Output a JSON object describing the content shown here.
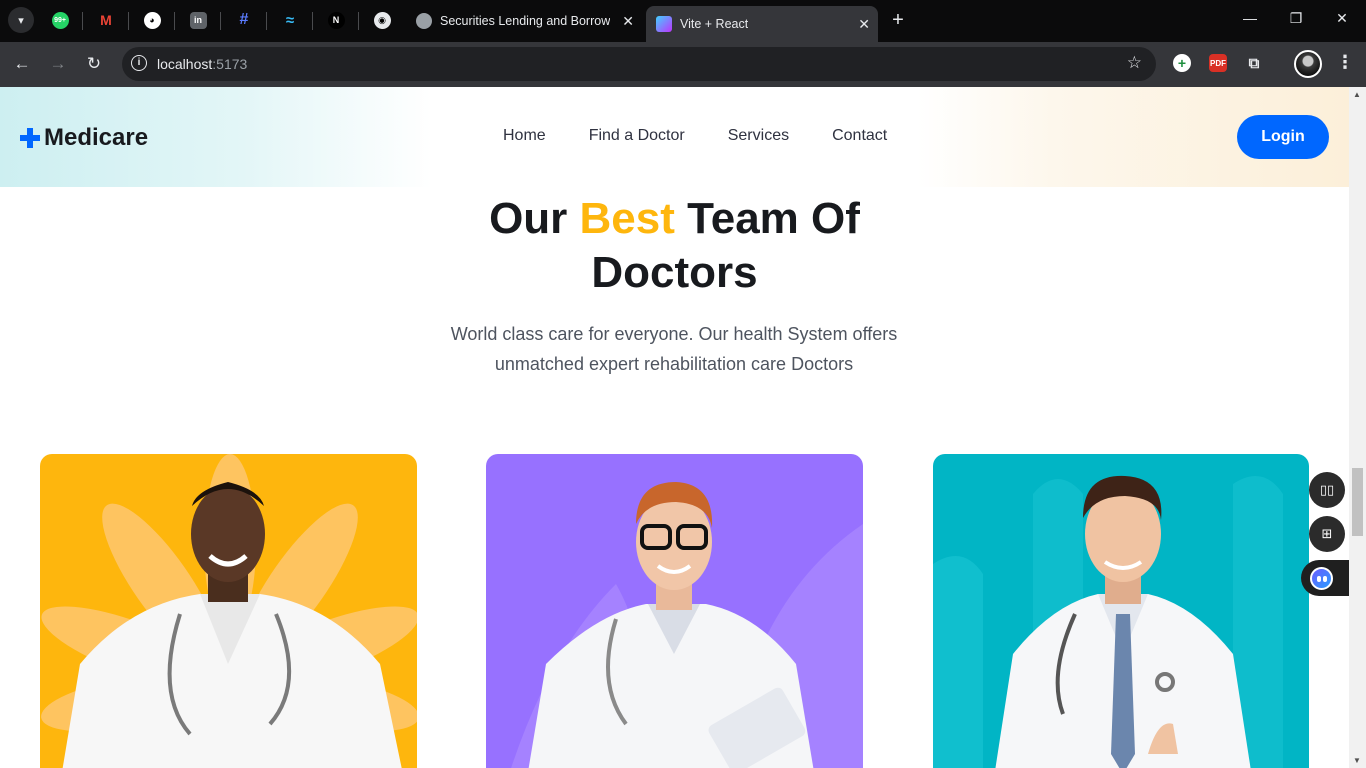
{
  "browser": {
    "tabs": [
      {
        "title": "Securities Lending and Borrowing",
        "active": false
      },
      {
        "title": "Vite + React",
        "active": true
      }
    ],
    "pinned_tabs": [
      {
        "icon": "whatsapp-icon",
        "badge": "99+",
        "color": "#25d366"
      },
      {
        "icon": "gmail-icon",
        "color": "#ea4335"
      },
      {
        "icon": "github-icon",
        "color": "#ffffff"
      },
      {
        "icon": "linkedin-icon",
        "color": "#0a66c2"
      },
      {
        "icon": "hashnode-icon",
        "color": "#2962ff"
      },
      {
        "icon": "tailwind-icon",
        "color": "#38bdf8"
      },
      {
        "icon": "nextjs-icon",
        "color": "#ffffff"
      },
      {
        "icon": "discord-like-icon",
        "color": "#ffffff"
      }
    ],
    "address": {
      "host": "localhost",
      "port": ":5173"
    }
  },
  "site": {
    "brand": "Medicare",
    "nav": [
      "Home",
      "Find a Doctor",
      "Services",
      "Contact"
    ],
    "login_label": "Login",
    "accent_color": "#0067ff",
    "highlight_color": "#feb60d"
  },
  "hero": {
    "heading_pre": "Our ",
    "heading_accent": "Best",
    "heading_post": " Team Of",
    "heading_line2": "Doctors",
    "subtext_line1": "World class care for everyone. Our health System offers",
    "subtext_line2": "unmatched expert rehabilitation care Doctors"
  },
  "doctors": [
    {
      "card_color": "#feb60d"
    },
    {
      "card_color": "#9771ff"
    },
    {
      "card_color": "#01b5c5"
    }
  ]
}
